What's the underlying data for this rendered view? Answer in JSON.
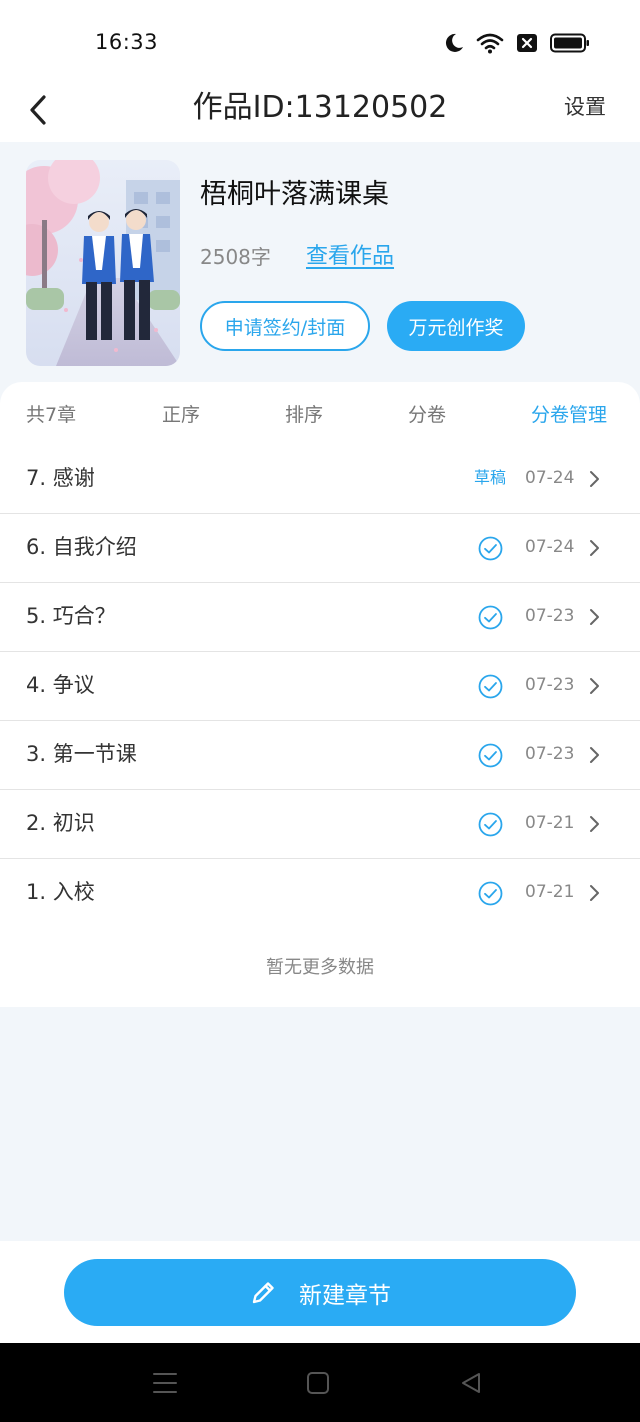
{
  "status_bar": {
    "time": "16:33",
    "icons": [
      "moon-icon",
      "wifi-icon",
      "sim-off-icon",
      "battery-icon"
    ]
  },
  "header": {
    "back_icon": "chevron-left-icon",
    "title": "作品ID:13120502",
    "settings_label": "设置"
  },
  "work": {
    "title": "梧桐叶落满课桌",
    "word_count": "2508字",
    "view_label": "查看作品",
    "sign_button": "申请签约/封面",
    "award_button": "万元创作奖"
  },
  "tabs": {
    "count_label": "共7章",
    "order_label": "正序",
    "sort_label": "排序",
    "volume_label": "分卷",
    "volume_manage_label": "分卷管理"
  },
  "chapters": [
    {
      "title": "7. 感谢",
      "status": "草稿",
      "date": "07-24"
    },
    {
      "title": "6. 自我介绍",
      "status": "published",
      "date": "07-24"
    },
    {
      "title": "5. 巧合？",
      "status": "published",
      "date": "07-23"
    },
    {
      "title": "4. 争议",
      "status": "published",
      "date": "07-23"
    },
    {
      "title": "3. 第一节课",
      "status": "published",
      "date": "07-23"
    },
    {
      "title": "2. 初识",
      "status": "published",
      "date": "07-21"
    },
    {
      "title": "1. 入校",
      "status": "published",
      "date": "07-21"
    }
  ],
  "no_more_text": "暂无更多数据",
  "new_chapter_button": "新建章节",
  "colors": {
    "accent": "#2aabf4",
    "link": "#2aa6ec",
    "background": "#f2f6fa"
  }
}
